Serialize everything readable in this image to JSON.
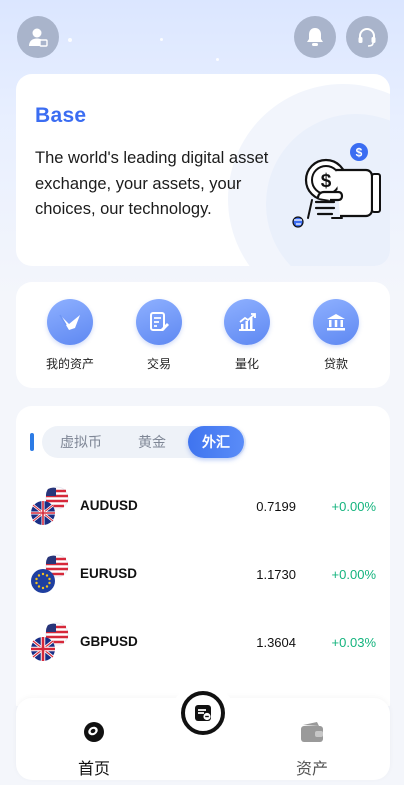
{
  "colors": {
    "accent": "#3b6df2",
    "up": "#14b47e",
    "tab_active": "#4a7ff3"
  },
  "topbar": {
    "profile_icon": "user-profile-icon",
    "notification_icon": "bell-icon",
    "support_icon": "headset-icon"
  },
  "hero": {
    "title": "Base",
    "tagline": "The world's leading digital asset exchange, your assets, your choices, our technology."
  },
  "quick_actions": [
    {
      "label": "我的资产",
      "icon": "wallet-swallow-icon"
    },
    {
      "label": "交易",
      "icon": "document-pen-icon"
    },
    {
      "label": "量化",
      "icon": "chart-up-icon"
    },
    {
      "label": "贷款",
      "icon": "bank-icon"
    }
  ],
  "market": {
    "tabs": [
      "虚拟币",
      "黄金",
      "外汇"
    ],
    "active_tab": "外汇",
    "rows": [
      {
        "pair": "AUDUSD",
        "price": "0.7199",
        "change": "+0.00%",
        "flag": "au-flag-icon"
      },
      {
        "pair": "EURUSD",
        "price": "1.1730",
        "change": "+0.00%",
        "flag": "eu-flag-icon"
      },
      {
        "pair": "GBPUSD",
        "price": "1.3604",
        "change": "+0.03%",
        "flag": "gb-flag-icon"
      }
    ]
  },
  "bottom_nav": {
    "home": "首页",
    "assets": "资产",
    "center_icon": "trade-exchange-icon"
  }
}
